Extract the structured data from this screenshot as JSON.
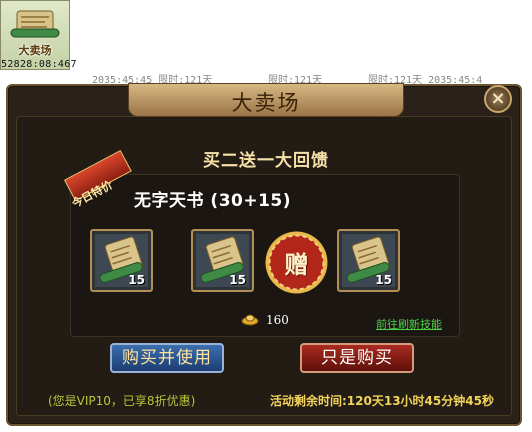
{
  "thumbnail": {
    "label": "大卖场",
    "coords": "52828:08:467"
  },
  "strip": {
    "text_1": "2035:45:45 限时:121天",
    "text_2": "限时:121天",
    "text_3": "限时:121天 2035:45:4"
  },
  "panel": {
    "title": "大卖场",
    "close_label": "×",
    "heading": "买二送一大回馈"
  },
  "offer": {
    "ribbon": "今日特价",
    "item_name": "无字天书 (30+15)",
    "slots": [
      {
        "icon": "scroll-icon",
        "count": "15"
      },
      {
        "icon": "scroll-icon",
        "count": "15"
      },
      {
        "icon": "scroll-icon",
        "count": "15"
      }
    ],
    "gift_label": "赠",
    "price": "160",
    "refresh_link": "前往刷新技能"
  },
  "buttons": {
    "buy_use": "购买并使用",
    "buy_only": "只是购买"
  },
  "footer": {
    "vip_note": "(您是VIP10，已享8折优惠)",
    "remaining": "活动剩余时间:120天13小时45分钟45秒"
  },
  "colors": {
    "panel_bg": "#2a221a",
    "gold_text": "#f6e1a8",
    "link_green": "#4ed04a"
  }
}
